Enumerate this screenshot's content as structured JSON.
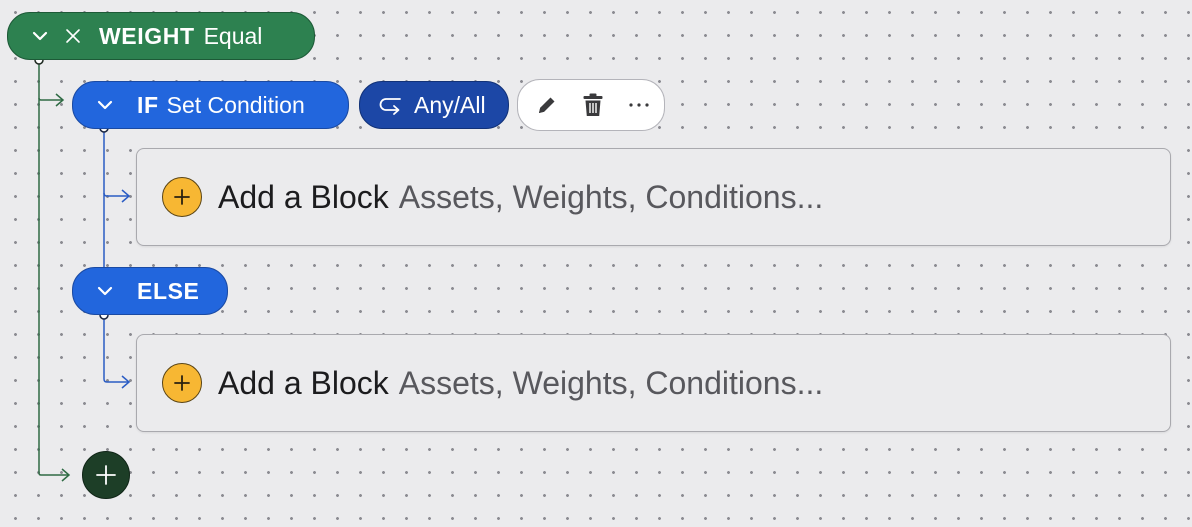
{
  "colors": {
    "background": "#ebebed",
    "weight_green": "#2d8150",
    "if_blue": "#2266dd",
    "anyall_blue": "#1c47a6",
    "add_yellow": "#f7b733",
    "add_node_green": "#1d3e27"
  },
  "weight_node": {
    "keyword": "WEIGHT",
    "mode": "Equal",
    "chevron_icon": "chevron-down-icon",
    "remove_icon": "close-icon"
  },
  "if_node": {
    "keyword": "IF",
    "label": "Set Condition",
    "chevron_icon": "chevron-down-icon"
  },
  "any_all": {
    "label": "Any/All",
    "icon": "loop-arrow-icon"
  },
  "actions": {
    "edit_icon": "pencil-icon",
    "delete_icon": "trash-icon",
    "more_icon": "more-horizontal-icon"
  },
  "else_node": {
    "keyword": "ELSE",
    "chevron_icon": "chevron-down-icon"
  },
  "blocks": [
    {
      "label": "Add a Block",
      "hint": "Assets, Weights, Conditions..."
    },
    {
      "label": "Add a Block",
      "hint": "Assets, Weights, Conditions..."
    }
  ],
  "add_node_icon": "plus-icon"
}
